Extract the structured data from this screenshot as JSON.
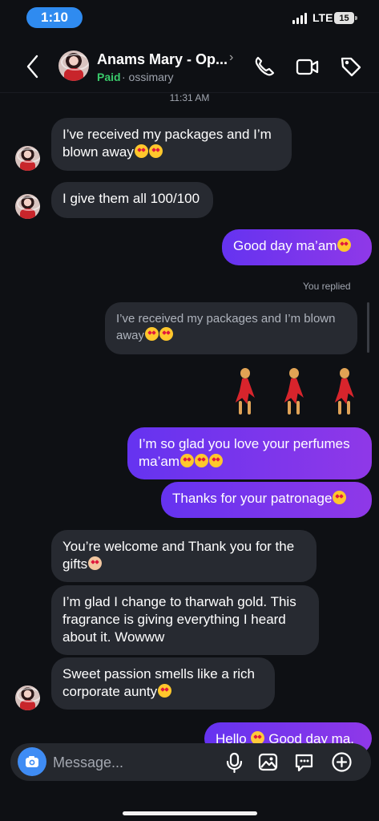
{
  "status_bar": {
    "time": "1:10",
    "network": "LTE",
    "battery": "15"
  },
  "conversation": {
    "contact_name": "Anams Mary - Op...",
    "paid_label": "Paid",
    "username": "· ossimary",
    "avatar_icon": "profile-photo-icon",
    "header_icons": [
      "back-icon",
      "phone-icon",
      "video-camera-icon",
      "tag-icon"
    ]
  },
  "messages": {
    "timestamp": "11:31 AM",
    "m1": "I’ve received my packages and I’m blown away",
    "m2": "I give them all 100/100",
    "m3": "Good day ma’am",
    "reply_label": "You replied",
    "m4": "I’ve received my packages and I’m blown away",
    "dancer_icon": "dancer-emoji-icon",
    "m5": "I’m so glad you love your perfumes ma’am",
    "m6": "Thanks for your patronage",
    "m7": "You’re welcome and Thank you for the gifts",
    "m8": "I’m glad I change to tharwah gold. This fragrance is giving everything I heard about it. Wowww",
    "m9": "Sweet passion smells like a rich corporate aunty",
    "m10": "Hello",
    "m10_tail": "Good day ma."
  },
  "composer": {
    "placeholder": "Message...",
    "icons": [
      "camera-icon",
      "microphone-icon",
      "photo-icon",
      "sticker-icon",
      "add-icon"
    ]
  },
  "colors": {
    "background": "#0e1014",
    "received_bubble": "#272a31",
    "sent_bubble_start": "#6533f0",
    "sent_bubble_end": "#8f38e8",
    "paid": "#39c96a",
    "accent": "#3f8cf4"
  }
}
